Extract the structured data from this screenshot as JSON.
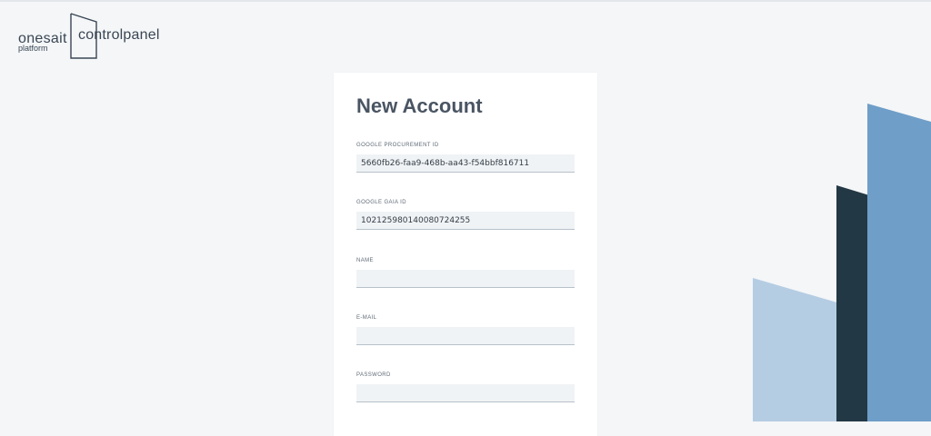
{
  "brand": {
    "name": "onesait",
    "subtitle": "platform",
    "product": "controlpanel"
  },
  "form": {
    "title": "New Account",
    "fields": [
      {
        "label": "GOOGLE PROCUREMENT ID",
        "value": "5660fb26-faa9-468b-aa43-f54bbf816711"
      },
      {
        "label": "GOOGLE GAIA ID",
        "value": "102125980140080724255"
      },
      {
        "label": "NAME",
        "value": ""
      },
      {
        "label": "E-MAIL",
        "value": ""
      },
      {
        "label": "PASSWORD",
        "value": ""
      }
    ]
  },
  "colors": {
    "background": "#f4f6f8",
    "card": "#ffffff",
    "input_bg": "#f0f3f5",
    "deco_light_blue": "#b5cde3",
    "deco_dark_navy": "#233845",
    "deco_mid_blue": "#6f9ec8"
  }
}
